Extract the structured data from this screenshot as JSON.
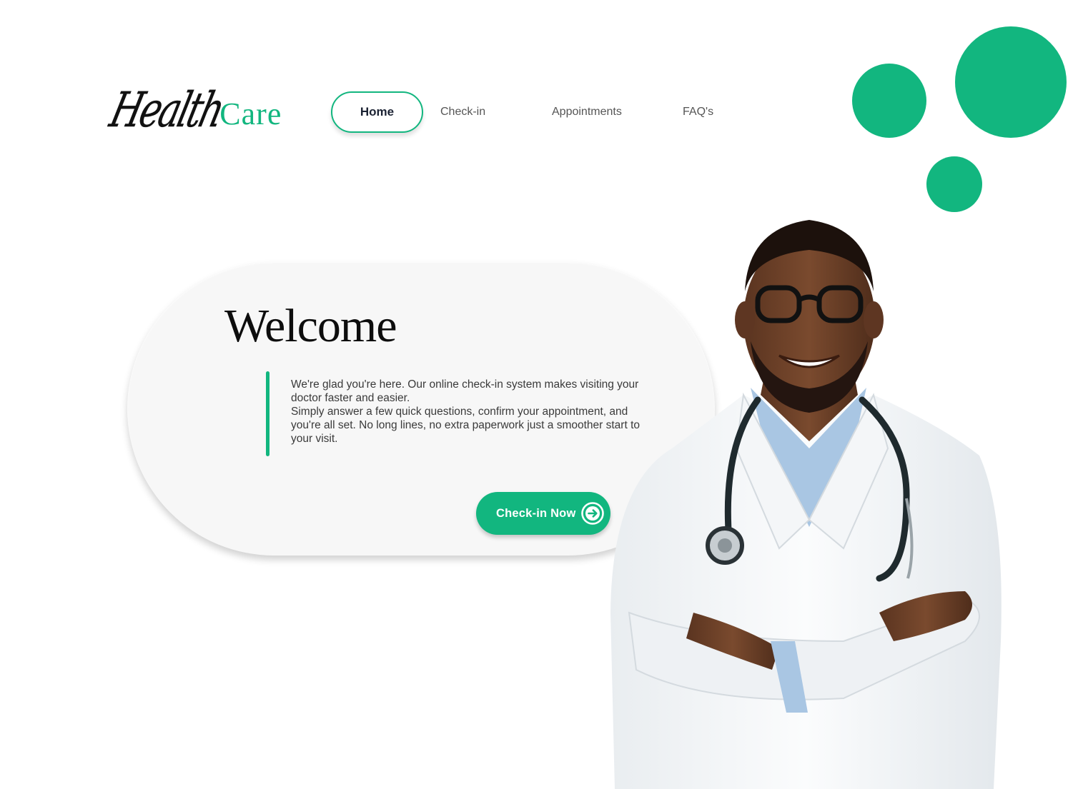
{
  "logo": {
    "script_text": "Health",
    "accent_text": "Care"
  },
  "nav": {
    "items": [
      {
        "label": "Home",
        "active": true
      },
      {
        "label": "Check-in",
        "active": false
      },
      {
        "label": "Appointments",
        "active": false
      },
      {
        "label": "FAQ's",
        "active": false
      }
    ]
  },
  "welcome": {
    "title": "Welcome",
    "paragraph_1": "We're glad you're here. Our online check-in system makes visiting your doctor faster and easier.",
    "paragraph_2": "Simply answer a few quick questions, confirm your appointment, and you're all set. No long lines, no extra paperwork just a smoother start to your visit.",
    "cta_label": "Check-in Now",
    "cta_icon": "arrow-right-circle-icon"
  },
  "hero_image": {
    "icon": "doctor-portrait"
  },
  "colors": {
    "accent": "#12b67f",
    "card_bg": "#f7f7f7",
    "text_dark": "#1b2233"
  }
}
